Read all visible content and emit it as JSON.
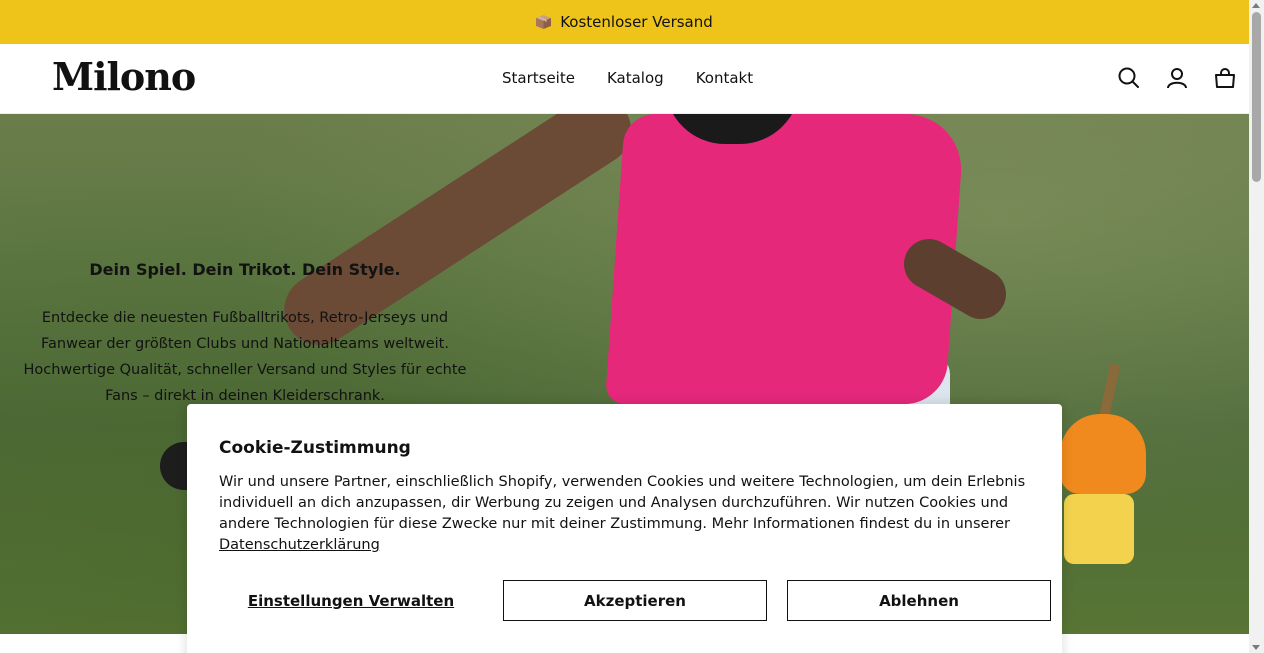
{
  "announcement": {
    "text": "Kostenloser Versand",
    "icon": "package-icon"
  },
  "header": {
    "logo": "Milono",
    "nav": [
      {
        "label": "Startseite"
      },
      {
        "label": "Katalog"
      },
      {
        "label": "Kontakt"
      }
    ],
    "icons": [
      "search-icon",
      "account-icon",
      "cart-icon"
    ]
  },
  "hero": {
    "title": "Dein Spiel. Dein Trikot. Dein Style.",
    "description": "Entdecke die neuesten Fußballtrikots, Retro-Jerseys und Fanwear der größten Clubs und Nationalteams weltweit. Hochwertige Qualität, schneller Versand und Styles für echte Fans – direkt in deinen Kleiderschrank."
  },
  "cookie": {
    "title": "Cookie-Zustimmung",
    "text": "Wir und unsere Partner, einschließlich Shopify, verwenden Cookies und weitere Technologien, um dein Erlebnis individuell an dich anzupassen, dir Werbung zu zeigen und Analysen durchzuführen. Wir nutzen Cookies und andere Technologien für diese Zwecke nur mit deiner Zustimmung. Mehr Informationen findest du in unserer",
    "policy_link": "Datenschutzerklärung",
    "manage_label": "Einstellungen Verwalten",
    "accept_label": "Akzeptieren",
    "decline_label": "Ablehnen"
  },
  "colors": {
    "announcement_bg": "#eec41a",
    "accent": "#e6287b"
  }
}
